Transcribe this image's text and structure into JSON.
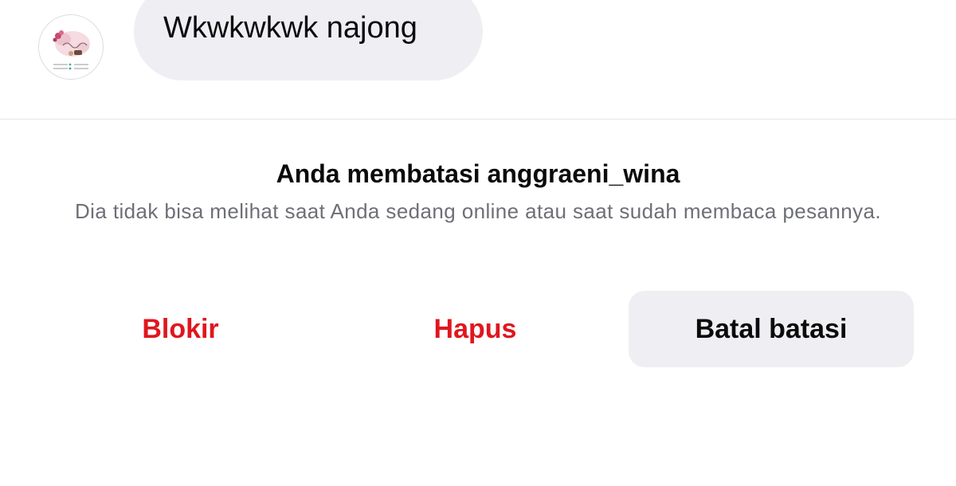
{
  "message": {
    "text": "Wkwkwkwk najong"
  },
  "notice": {
    "title": "Anda membatasi anggraeni_wina",
    "description": "Dia tidak bisa melihat saat Anda sedang online atau saat sudah membaca pesannya."
  },
  "actions": {
    "block_label": "Blokir",
    "delete_label": "Hapus",
    "unrestrict_label": "Batal batasi"
  },
  "colors": {
    "danger": "#e0161e",
    "bubble_background": "#efeff3",
    "secondary_text": "#6e6f77"
  }
}
